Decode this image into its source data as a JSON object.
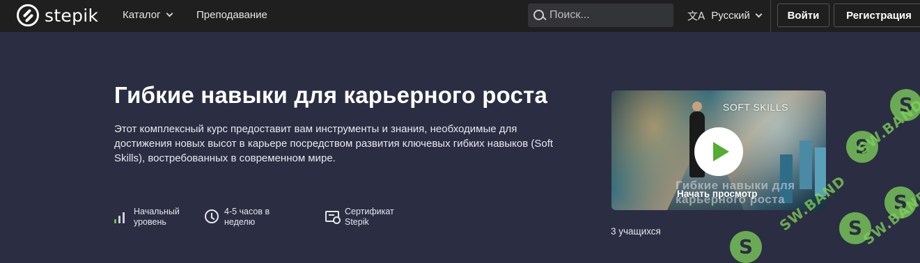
{
  "header": {
    "logo_text": "stepik",
    "nav": {
      "catalog": "Каталог",
      "teaching": "Преподавание"
    },
    "search_placeholder": "Поиск...",
    "language": "Русский",
    "login": "Войти",
    "register": "Регистрация"
  },
  "course": {
    "title": "Гибкие навыки для карьерного роста",
    "description": "Этот комплексный курс предоставит вам инструменты и знания, необходимые для достижения новых высот в карьере посредством развития ключевых гибких навыков (Soft Skills), востребованных в современном мире.",
    "features": [
      {
        "line1": "Начальный",
        "line2": "уровень",
        "icon": "level-bars-icon"
      },
      {
        "line1": "4-5 часов в",
        "line2": "неделю",
        "icon": "clock-icon"
      },
      {
        "line1": "Сертификат",
        "line2": "Stepik",
        "icon": "certificate-icon"
      }
    ],
    "video": {
      "image_caption": "SOFT SKILLS",
      "image_title": "Гибкие навыки для карьерного роста",
      "play_label": "Начать просмотр"
    },
    "learners": "3 учащихся"
  },
  "watermark": {
    "text": "SW.BAND"
  },
  "colors": {
    "background": "#2b2d42",
    "topbar": "#1f1f1f",
    "accent_green": "#54ad32",
    "watermark_green": "#7fd45a"
  }
}
